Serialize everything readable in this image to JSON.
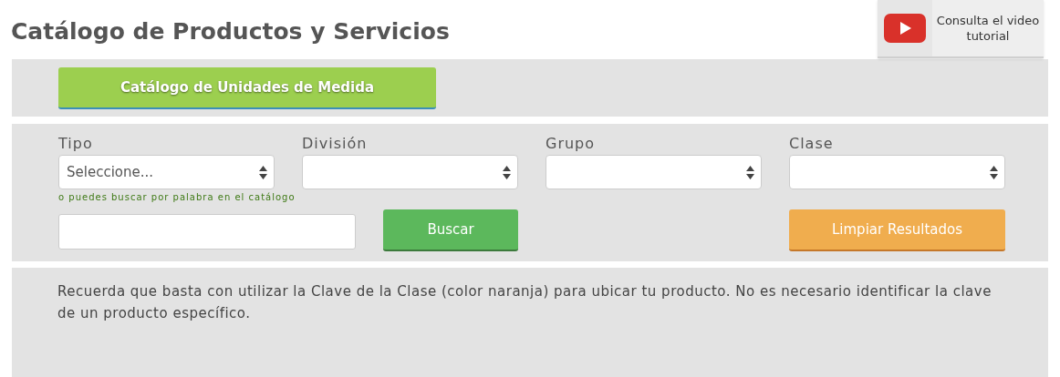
{
  "title": "Catálogo de Productos y Servicios",
  "video_button": {
    "label": "Consulta el video tutorial"
  },
  "units_button": {
    "label": "Catálogo de Unidades de Medida"
  },
  "filters": [
    {
      "label": "Tipo",
      "value": "Seleccione..."
    },
    {
      "label": "División"
    },
    {
      "label": "Grupo"
    },
    {
      "label": "Clase"
    }
  ],
  "hint": "o puedes buscar por palabra en el catálogo",
  "search_button": {
    "label": "Buscar"
  },
  "clear_button": {
    "label": "Limpiar Resultados"
  },
  "note": "Recuerda que basta con utilizar la Clave de la Clase (color naranja) para ubicar tu producto. No es necesario identificar la clave de un producto específico."
}
